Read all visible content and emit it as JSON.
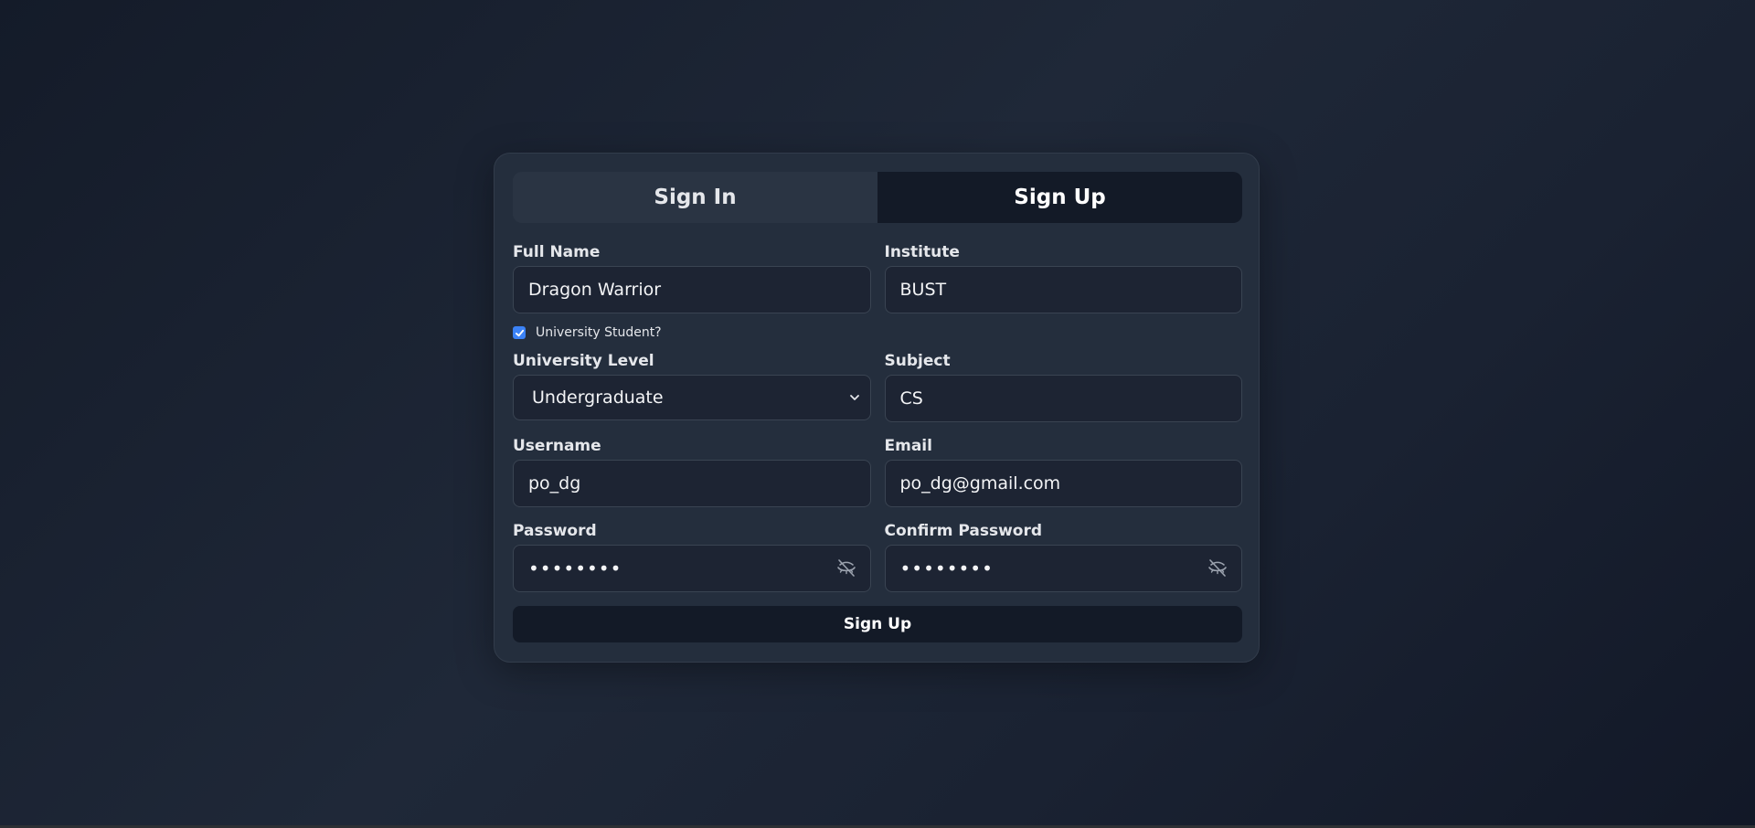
{
  "tabs": {
    "sign_in": "Sign In",
    "sign_up": "Sign Up",
    "active": "sign_up"
  },
  "form": {
    "full_name": {
      "label": "Full Name",
      "value": "Dragon Warrior"
    },
    "institute": {
      "label": "Institute",
      "value": "BUST"
    },
    "university_student": {
      "label": "University Student?",
      "checked": true
    },
    "university_level": {
      "label": "University Level",
      "value": "Undergraduate"
    },
    "subject": {
      "label": "Subject",
      "value": "CS"
    },
    "username": {
      "label": "Username",
      "value": "po_dg"
    },
    "email": {
      "label": "Email",
      "value": "po_dg@gmail.com"
    },
    "password": {
      "label": "Password",
      "masked": "••••••••"
    },
    "confirm_password": {
      "label": "Confirm Password",
      "masked": "••••••••"
    },
    "submit_label": "Sign Up"
  },
  "icons": {
    "password_toggle": "eye-off-icon",
    "confirm_password_toggle": "eye-off-icon",
    "select_chevron": "chevron-down-icon",
    "checkbox_check": "check-icon"
  },
  "colors": {
    "accent": "#3b82f6",
    "active_tab": "#131a27",
    "submit_button": "#131a27"
  }
}
